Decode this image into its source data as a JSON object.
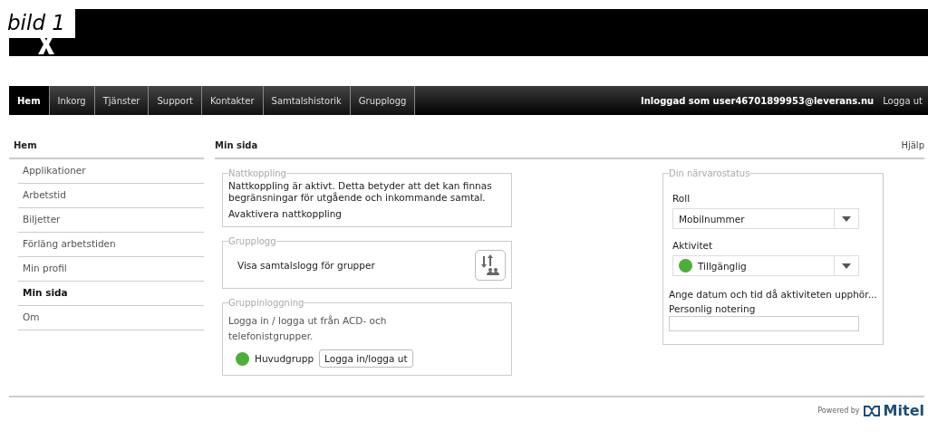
{
  "figure_label": "bild 1",
  "nav": {
    "tabs": [
      {
        "label": "Hem",
        "selected": true
      },
      {
        "label": "Inkorg",
        "selected": false
      },
      {
        "label": "Tjänster",
        "selected": false
      },
      {
        "label": "Support",
        "selected": false
      },
      {
        "label": "Kontakter",
        "selected": false
      },
      {
        "label": "Samtalshistorik",
        "selected": false
      },
      {
        "label": "Grupplogg",
        "selected": false
      }
    ],
    "user": "Inloggad som user46701899953@leverans.nu",
    "logout": "Logga ut"
  },
  "sidebar": {
    "title": "Hem",
    "items": [
      {
        "label": "Applikationer",
        "selected": false
      },
      {
        "label": "Arbetstid",
        "selected": false
      },
      {
        "label": "Biljetter",
        "selected": false
      },
      {
        "label": "Förläng arbetstiden",
        "selected": false
      },
      {
        "label": "Min profil",
        "selected": false
      },
      {
        "label": "Min sida",
        "selected": true
      },
      {
        "label": "Om",
        "selected": false
      }
    ]
  },
  "main": {
    "title": "Min sida",
    "help": "Hjälp",
    "night": {
      "legend": "Nattkoppling",
      "text": "Nattkoppling är aktivt. Detta betyder att det kan finnas begränsningar för utgående och inkommande samtal.",
      "link": "Avaktivera nattkoppling"
    },
    "grouplog": {
      "legend": "Grupplogg",
      "text": "Visa samtalslogg för grupper"
    },
    "grouplogin": {
      "legend": "Gruppinloggning",
      "text": "Logga in / logga ut från ACD- och telefonistgrupper.",
      "groups": [
        {
          "name": "Huvudgrupp",
          "color": "#4caf3a"
        }
      ],
      "button": "Logga in/logga ut"
    },
    "presence": {
      "legend": "Din närvarostatus",
      "role_label": "Roll",
      "role": "Mobilnummer",
      "activity_label": "Aktivitet",
      "activity": {
        "label": "Tillgänglig",
        "color": "#4caf3a"
      },
      "end_link": "Ange datum och tid då aktiviteten upphör...",
      "note_label": "Personlig notering"
    }
  },
  "footer": {
    "powered": "Powered by",
    "brand": "Mitel"
  }
}
